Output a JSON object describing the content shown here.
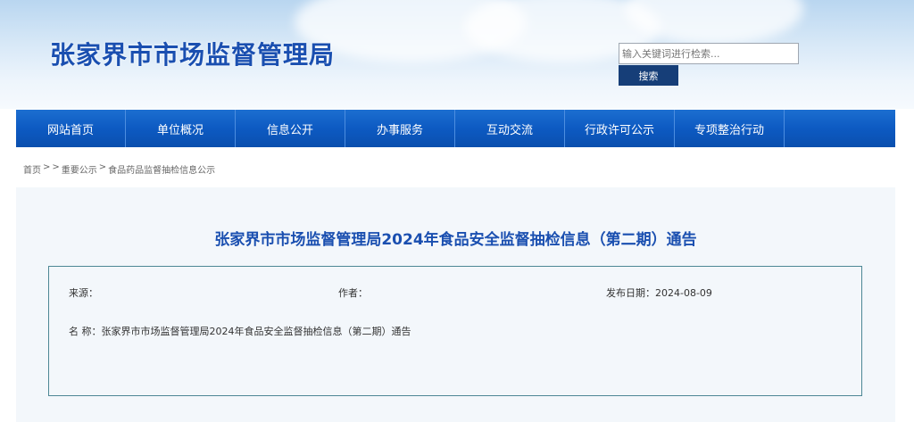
{
  "site": {
    "title": "张家界市市场监督管理局"
  },
  "search": {
    "placeholder": "输入关键词进行检索...",
    "button_label": "搜索"
  },
  "nav": {
    "items": [
      "网站首页",
      "单位概况",
      "信息公开",
      "办事服务",
      "互动交流",
      "行政许可公示",
      "专项整治行动",
      ""
    ]
  },
  "breadcrumb": {
    "home": "首页",
    "sep1": ">",
    "sep2": ">",
    "level1": "重要公示",
    "sep3": ">",
    "level2": "食品药品监督抽检信息公示"
  },
  "article": {
    "title": "张家界市市场监督管理局2024年食品安全监督抽检信息（第二期）通告",
    "source_label": "来源：",
    "source_value": "",
    "author_label": "作者：",
    "author_value": "",
    "date_label": "发布日期：",
    "date_value": "2024-08-09",
    "name_label": "名 称：",
    "name_value": "张家界市市场监督管理局2024年食品安全监督抽检信息（第二期）通告"
  }
}
